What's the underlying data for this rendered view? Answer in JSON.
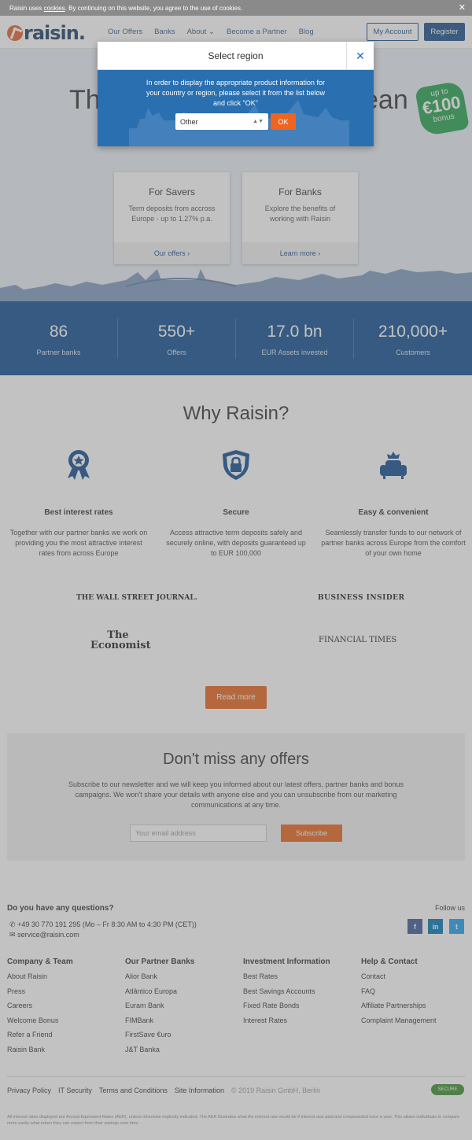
{
  "cookie": {
    "pre": "Raisin uses ",
    "link": "cookies",
    "post": ". By continuing on this website, you agree to the use of cookies.",
    "close": "✕"
  },
  "nav": {
    "logo": "raisin.",
    "links": [
      "Our Offers",
      "Banks",
      "About ⌄",
      "Become a Partner",
      "Blog"
    ],
    "account": "My Account",
    "register": "Register"
  },
  "hero": {
    "title_left": "The",
    "title_right": "ean",
    "badge": {
      "l1": "up to",
      "l2": "€100",
      "l3": "bonus"
    },
    "cards": [
      {
        "title": "For Savers",
        "text": "Term deposits from accross Europe - up to 1.27% p.a.",
        "cta": "Our offers ›"
      },
      {
        "title": "For Banks",
        "text": "Explore the benefits of working with Raisin",
        "cta": "Learn more ›"
      }
    ]
  },
  "stats": [
    {
      "num": "86",
      "label": "Partner banks"
    },
    {
      "num": "550+",
      "label": "Offers"
    },
    {
      "num": "17.0 bn",
      "label": "EUR Assets invested"
    },
    {
      "num": "210,000+",
      "label": "Customers"
    }
  ],
  "why": {
    "title": "Why Raisin?",
    "features": [
      {
        "title": "Best interest rates",
        "text": "Together with our partner banks we work on providing you the most attractive interest rates from across Europe"
      },
      {
        "title": "Secure",
        "text": "Access attractive term deposits safely and securely online, with deposits guaranteed up to EUR 100,000"
      },
      {
        "title": "Easy & convenient",
        "text": "Seamlessly transfer funds to our network of partner banks across Europe from the comfort of your own home"
      }
    ]
  },
  "press": {
    "wsj": "THE WALL STREET JOURNAL.",
    "bi": "BUSINESS INSIDER",
    "eco1": "The",
    "eco2": "Economist",
    "ft": "FINANCIAL TIMES"
  },
  "read_more": "Read more",
  "newsletter": {
    "title": "Don't miss any offers",
    "text": "Subscribe to our newsletter and we will keep you informed about our latest offers, partner banks and bonus campaigns. We won't share your details with anyone else and you can unsubscribe from our marketing communications at any time.",
    "placeholder": "Your email address",
    "button": "Subscribe"
  },
  "contact": {
    "title": "Do you have any questions?",
    "phone": "+49 30 770 191 295 (Mo – Fr 8:30 AM to 4:30 PM (CET))",
    "email": "service@raisin.com",
    "follow": "Follow us",
    "social": [
      "f",
      "in",
      "t"
    ]
  },
  "footer_cols": [
    {
      "title": "Company & Team",
      "items": [
        "About Raisin",
        "Press",
        "Careers",
        "Welcome Bonus",
        "Refer a Friend",
        "Raisin Bank"
      ]
    },
    {
      "title": "Our Partner Banks",
      "items": [
        "Alior Bank",
        "Atlântico Europa",
        "Euram Bank",
        "FIMBank",
        "FirstSave €uro",
        "J&T Banka"
      ]
    },
    {
      "title": "Investment Information",
      "items": [
        "Best Rates",
        "Best Savings Accounts",
        "Fixed Rate Bonds",
        "Interest Rates"
      ]
    },
    {
      "title": "Help & Contact",
      "items": [
        "Contact",
        "FAQ",
        "Affiliate Partnerships",
        "Complaint Management"
      ]
    }
  ],
  "legal": {
    "links": [
      "Privacy Policy",
      "IT Security",
      "Terms and Conditions",
      "Site Information"
    ],
    "copyright": "© 2019 Raisin GmbH, Berlin",
    "secure": "SECURE",
    "fineprint": "All interest rates displayed are Annual Equivalent Rates (AER), unless otherwise explicitly indicated. The AER illustrates what the interest rate would be if interest was paid and compounded once a year. This allows individuals to compare more easily what return they can expect from their savings over time."
  },
  "modal": {
    "title": "Select region",
    "close": "✕",
    "text": "In order to display the appropriate product information for your country or region, please select it from the list below and click \"OK\"",
    "selected": "Other",
    "ok": "OK"
  },
  "colors": {
    "brand_blue": "#1a4e8c",
    "accent_orange": "#e8641a",
    "badge_green": "#21a34d"
  }
}
